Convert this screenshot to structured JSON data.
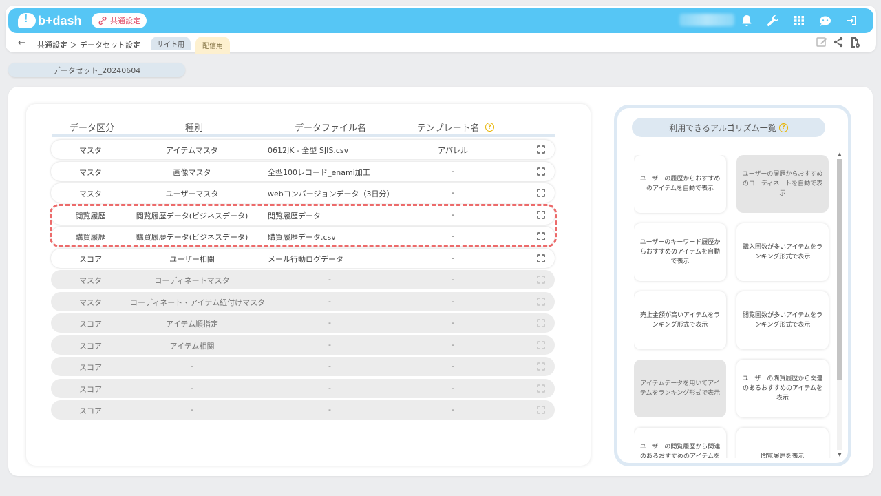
{
  "header": {
    "logo_text": "b+dash",
    "shared_settings_label": "共通設定"
  },
  "subbar": {
    "back": "←",
    "breadcrumb": "共通設定 ＞ データセット設定",
    "site_tab": "サイト用",
    "dist_tab": "配信用"
  },
  "dataset_tab": "データセット_20240604",
  "table": {
    "headers": [
      "データ区分",
      "種別",
      "データファイル名",
      "テンプレート名"
    ],
    "rows": [
      {
        "category": "マスタ",
        "type": "アイテムマスタ",
        "file": "0612JK - 全型 SJIS.csv",
        "template": "アパレル",
        "active": true
      },
      {
        "category": "マスタ",
        "type": "画像マスタ",
        "file": "全型100レコード_enami加工",
        "template": "-",
        "active": true
      },
      {
        "category": "マスタ",
        "type": "ユーザーマスタ",
        "file": "webコンバージョンデータ（3日分）",
        "template": "-",
        "active": true
      },
      {
        "category": "閲覧履歴",
        "type": "閲覧履歴データ(ビジネスデータ)",
        "file": "閲覧履歴データ",
        "template": "-",
        "active": true
      },
      {
        "category": "購買履歴",
        "type": "購買履歴データ(ビジネスデータ)",
        "file": "購買履歴データ.csv",
        "template": "-",
        "active": true
      },
      {
        "category": "スコア",
        "type": "ユーザー相関",
        "file": "メール行動ログデータ",
        "template": "-",
        "active": true
      },
      {
        "category": "マスタ",
        "type": "コーディネートマスタ",
        "file": "-",
        "template": "-",
        "active": false
      },
      {
        "category": "マスタ",
        "type": "コーディネート・アイテム紐付けマスタ",
        "file": "-",
        "template": "-",
        "active": false
      },
      {
        "category": "スコア",
        "type": "アイテム順指定",
        "file": "-",
        "template": "-",
        "active": false
      },
      {
        "category": "スコア",
        "type": "アイテム相関",
        "file": "-",
        "template": "-",
        "active": false
      },
      {
        "category": "スコア",
        "type": "-",
        "file": "-",
        "template": "-",
        "active": false
      },
      {
        "category": "スコア",
        "type": "-",
        "file": "-",
        "template": "-",
        "active": false
      },
      {
        "category": "スコア",
        "type": "-",
        "file": "-",
        "template": "-",
        "active": false
      }
    ]
  },
  "algorithms": {
    "title": "利用できるアルゴリズム一覧",
    "items": [
      {
        "label": "ユーザーの履歴からおすすめのアイテムを自動で表示",
        "active": true
      },
      {
        "label": "ユーザーの履歴からおすすめのコーディネートを自動で表示",
        "active": false
      },
      {
        "label": "ユーザーのキーワード履歴からおすすめのアイテムを自動で表示",
        "active": true
      },
      {
        "label": "購入回数が多いアイテムをランキング形式で表示",
        "active": true
      },
      {
        "label": "売上金額が高いアイテムをランキング形式で表示",
        "active": true
      },
      {
        "label": "閲覧回数が多いアイテムをランキング形式で表示",
        "active": true
      },
      {
        "label": "アイテムデータを用いてアイテムをランキング形式で表示",
        "active": false
      },
      {
        "label": "ユーザーの購買履歴から関連のあるおすすめのアイテムを表示",
        "active": true
      },
      {
        "label": "ユーザーの閲覧履歴から関連のあるおすすめのアイテムを表示",
        "active": true
      },
      {
        "label": "閲覧履歴を表示",
        "active": true
      }
    ]
  },
  "colors": {
    "topbar": "#56c6f5",
    "highlight": "#ec6b6b",
    "help": "#e8b400"
  }
}
